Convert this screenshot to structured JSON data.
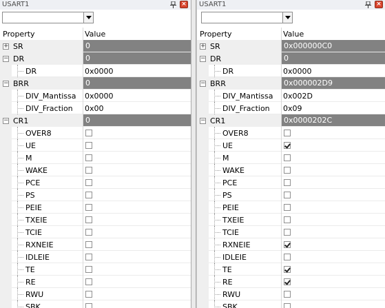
{
  "colors": {
    "group_value_bg": "#828282",
    "group_row_bg": "#efefef",
    "close_button": "#d9452e"
  },
  "panels": [
    {
      "title": "USART1",
      "combo_value": "",
      "header": {
        "property": "Property",
        "value": "Value"
      },
      "rows": [
        {
          "kind": "group",
          "expander": "plus",
          "label": "SR",
          "value": "0"
        },
        {
          "kind": "group",
          "expander": "minus",
          "label": "DR",
          "value": "0"
        },
        {
          "kind": "field",
          "label": "DR",
          "value": "0x0000"
        },
        {
          "kind": "group",
          "expander": "minus",
          "label": "BRR",
          "value": "0"
        },
        {
          "kind": "field",
          "label": "DIV_Mantissa",
          "value": "0x0000"
        },
        {
          "kind": "field",
          "label": "DIV_Fraction",
          "value": "0x00"
        },
        {
          "kind": "group",
          "expander": "minus",
          "label": "CR1",
          "value": "0"
        },
        {
          "kind": "bit",
          "label": "OVER8",
          "checked": false
        },
        {
          "kind": "bit",
          "label": "UE",
          "checked": false
        },
        {
          "kind": "bit",
          "label": "M",
          "checked": false
        },
        {
          "kind": "bit",
          "label": "WAKE",
          "checked": false
        },
        {
          "kind": "bit",
          "label": "PCE",
          "checked": false
        },
        {
          "kind": "bit",
          "label": "PS",
          "checked": false
        },
        {
          "kind": "bit",
          "label": "PEIE",
          "checked": false
        },
        {
          "kind": "bit",
          "label": "TXEIE",
          "checked": false
        },
        {
          "kind": "bit",
          "label": "TCIE",
          "checked": false
        },
        {
          "kind": "bit",
          "label": "RXNEIE",
          "checked": false
        },
        {
          "kind": "bit",
          "label": "IDLEIE",
          "checked": false
        },
        {
          "kind": "bit",
          "label": "TE",
          "checked": false
        },
        {
          "kind": "bit",
          "label": "RE",
          "checked": false
        },
        {
          "kind": "bit",
          "label": "RWU",
          "checked": false
        },
        {
          "kind": "bit",
          "label": "SBK",
          "checked": false
        }
      ]
    },
    {
      "title": "USART1",
      "combo_value": "",
      "header": {
        "property": "Property",
        "value": "Value"
      },
      "rows": [
        {
          "kind": "group",
          "expander": "plus",
          "label": "SR",
          "value": "0x000000C0"
        },
        {
          "kind": "group",
          "expander": "minus",
          "label": "DR",
          "value": "0"
        },
        {
          "kind": "field",
          "label": "DR",
          "value": "0x0000"
        },
        {
          "kind": "group",
          "expander": "minus",
          "label": "BRR",
          "value": "0x000002D9"
        },
        {
          "kind": "field",
          "label": "DIV_Mantissa",
          "value": "0x002D"
        },
        {
          "kind": "field",
          "label": "DIV_Fraction",
          "value": "0x09"
        },
        {
          "kind": "group",
          "expander": "minus",
          "label": "CR1",
          "value": "0x0000202C"
        },
        {
          "kind": "bit",
          "label": "OVER8",
          "checked": false
        },
        {
          "kind": "bit",
          "label": "UE",
          "checked": true
        },
        {
          "kind": "bit",
          "label": "M",
          "checked": false
        },
        {
          "kind": "bit",
          "label": "WAKE",
          "checked": false
        },
        {
          "kind": "bit",
          "label": "PCE",
          "checked": false
        },
        {
          "kind": "bit",
          "label": "PS",
          "checked": false
        },
        {
          "kind": "bit",
          "label": "PEIE",
          "checked": false
        },
        {
          "kind": "bit",
          "label": "TXEIE",
          "checked": false
        },
        {
          "kind": "bit",
          "label": "TCIE",
          "checked": false
        },
        {
          "kind": "bit",
          "label": "RXNEIE",
          "checked": true
        },
        {
          "kind": "bit",
          "label": "IDLEIE",
          "checked": false
        },
        {
          "kind": "bit",
          "label": "TE",
          "checked": true
        },
        {
          "kind": "bit",
          "label": "RE",
          "checked": true
        },
        {
          "kind": "bit",
          "label": "RWU",
          "checked": false
        },
        {
          "kind": "bit",
          "label": "SBK",
          "checked": false
        }
      ]
    }
  ]
}
